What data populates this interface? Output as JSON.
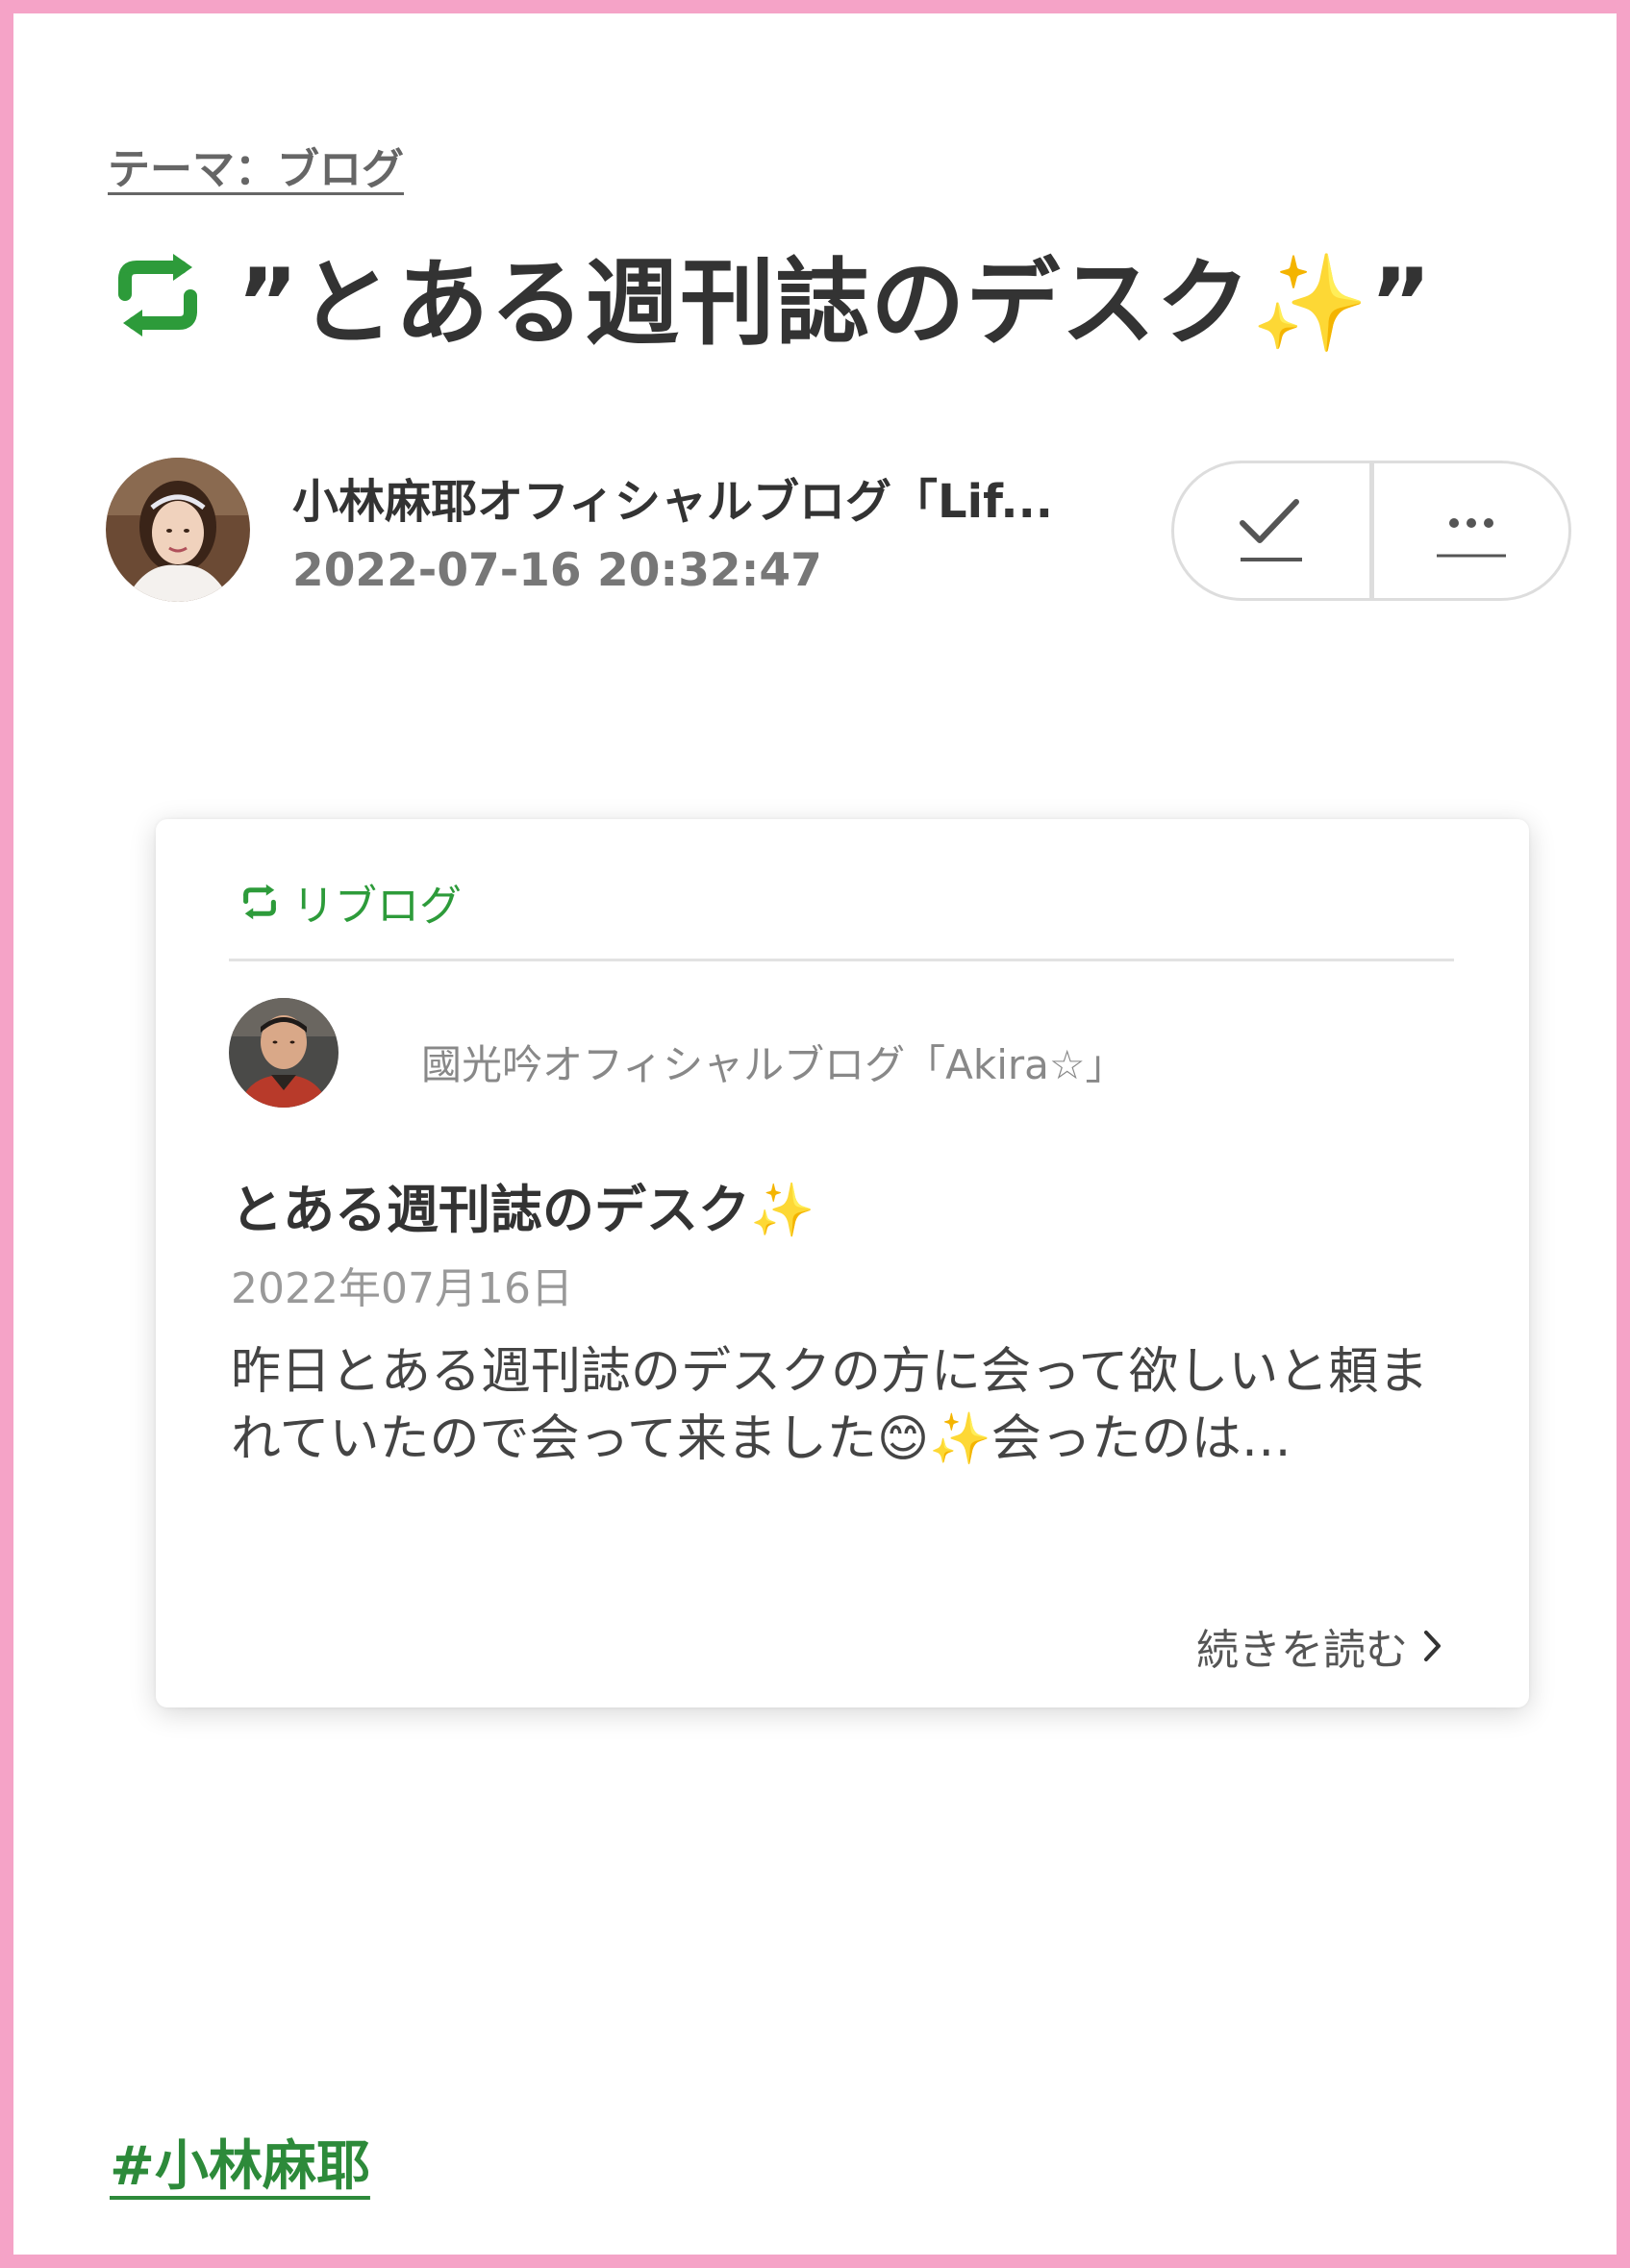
{
  "theme": {
    "label": "テーマ：ブログ"
  },
  "entry": {
    "title": "”とある週刊誌のデスク✨”",
    "author_name": "小林麻耶オフィシャルブログ「Lif...",
    "date": "2022-07-16 20:32:47"
  },
  "actions": {
    "check_icon": "checkmark-icon",
    "more_icon": "more-horizontal-icon"
  },
  "reblog_card": {
    "label": "リブログ",
    "blog_name": "國光吟オフィシャルブログ「Akira☆」",
    "title": "とある週刊誌のデスク✨",
    "date": "2022年07月16日",
    "excerpt": "昨日とある週刊誌のデスクの方に会って欲しいと頼まれていたので会って来ました😊✨会ったのは…",
    "read_more": "続きを読む"
  },
  "hashtag": {
    "label": "#小林麻耶"
  },
  "colors": {
    "frame": "#f5a3c7",
    "reblog_green": "#2d9b3a",
    "hashtag_green": "#2d8a3a"
  }
}
